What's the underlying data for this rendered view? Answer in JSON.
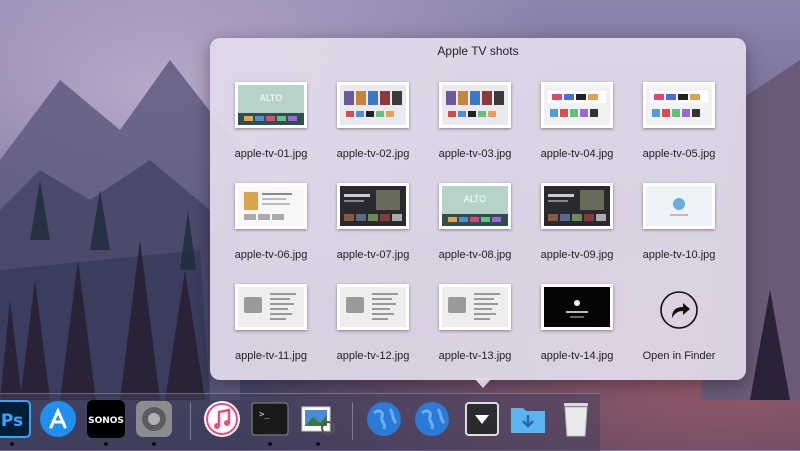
{
  "stack": {
    "title": "Apple TV shots",
    "items": [
      {
        "label": "apple-tv-01.jpg",
        "theme": "alto"
      },
      {
        "label": "apple-tv-02.jpg",
        "theme": "grid-color"
      },
      {
        "label": "apple-tv-03.jpg",
        "theme": "grid-color"
      },
      {
        "label": "apple-tv-04.jpg",
        "theme": "light-tiles"
      },
      {
        "label": "apple-tv-05.jpg",
        "theme": "light-tiles"
      },
      {
        "label": "apple-tv-06.jpg",
        "theme": "light-doc"
      },
      {
        "label": "apple-tv-07.jpg",
        "theme": "dark"
      },
      {
        "label": "apple-tv-08.jpg",
        "theme": "alto"
      },
      {
        "label": "apple-tv-09.jpg",
        "theme": "dark"
      },
      {
        "label": "apple-tv-10.jpg",
        "theme": "blank"
      },
      {
        "label": "apple-tv-11.jpg",
        "theme": "settings"
      },
      {
        "label": "apple-tv-12.jpg",
        "theme": "settings"
      },
      {
        "label": "apple-tv-13.jpg",
        "theme": "settings"
      },
      {
        "label": "apple-tv-14.jpg",
        "theme": "black-apple"
      }
    ],
    "open_in_finder_label": "Open in Finder"
  },
  "dock": {
    "items": [
      {
        "name": "photoshop-icon",
        "text": "Ps",
        "running": true
      },
      {
        "name": "app-store-icon",
        "text": "",
        "running": false
      },
      {
        "name": "sonos-icon",
        "text": "SONOS",
        "running": true
      },
      {
        "name": "system-preferences-icon",
        "text": "",
        "running": true
      },
      {
        "name": "itunes-icon",
        "text": "",
        "running": false
      },
      {
        "name": "terminal-icon",
        "text": ">_",
        "running": true
      },
      {
        "name": "preview-icon",
        "text": "",
        "running": true
      },
      {
        "name": "globe-icon-1",
        "text": "",
        "running": false
      },
      {
        "name": "globe-icon-2",
        "text": "",
        "running": false
      },
      {
        "name": "stack-toggle-icon",
        "text": "",
        "running": false
      },
      {
        "name": "downloads-folder-icon",
        "text": "",
        "running": false
      },
      {
        "name": "trash-icon",
        "text": "",
        "running": false
      }
    ]
  },
  "colors": {
    "ps_blue": "#31a8ff",
    "ps_bg": "#001e36",
    "appstore": "#1f8ff0",
    "globe": "#2a7ad6",
    "folder": "#5ab4f0"
  }
}
